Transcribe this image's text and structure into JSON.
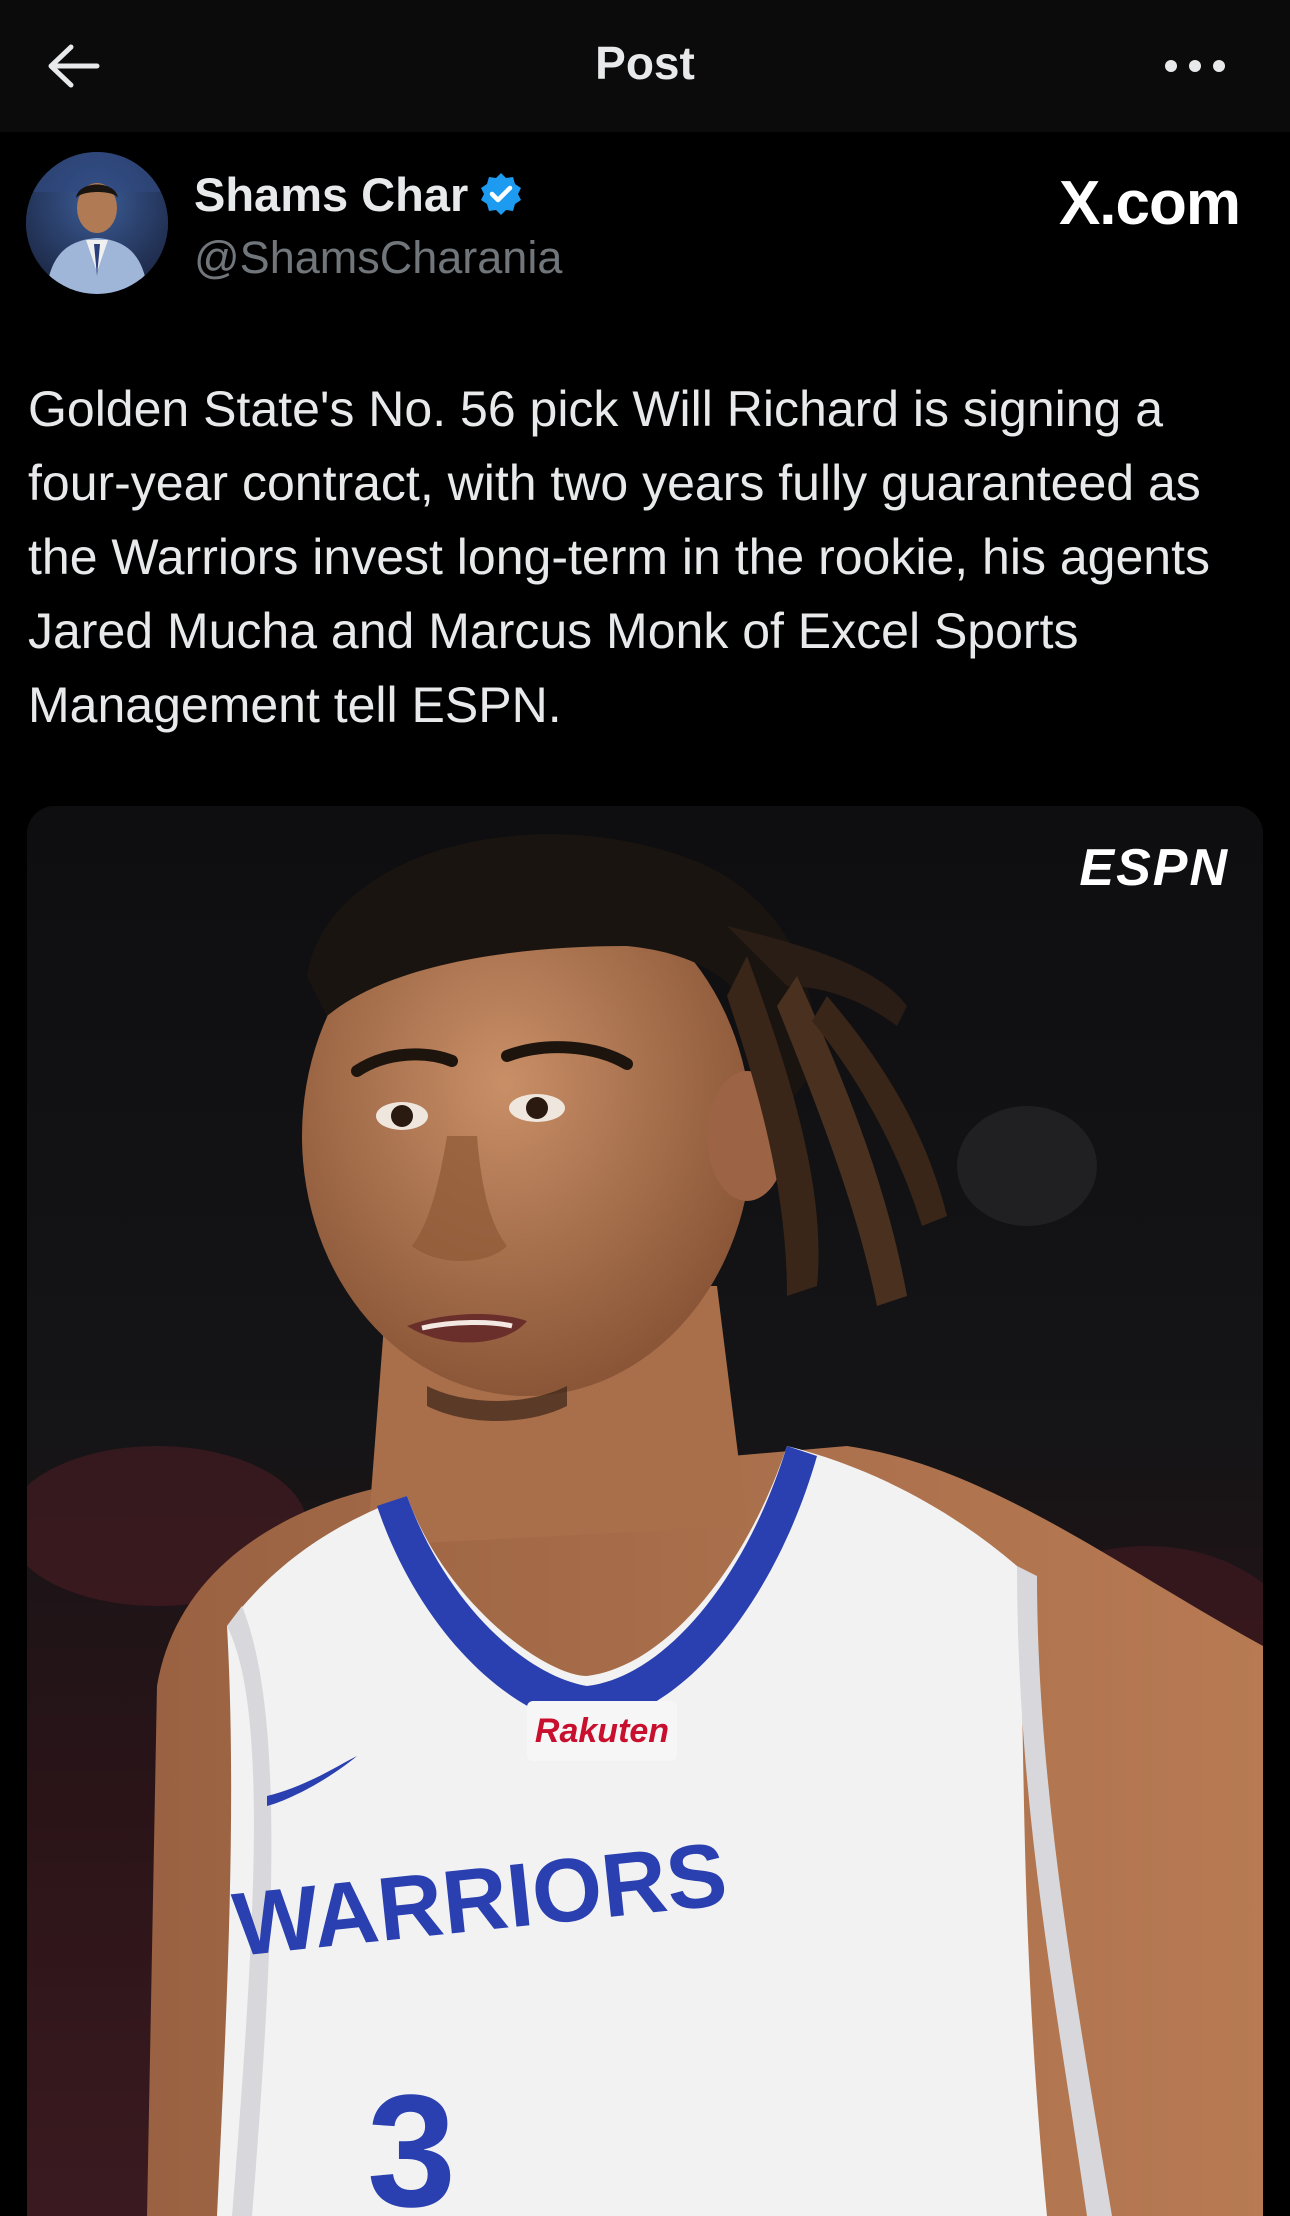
{
  "header": {
    "title": "Post",
    "back_icon": "arrow-left-icon",
    "more_icon": "more-horizontal-icon"
  },
  "author": {
    "display_name": "Shams Char",
    "handle": "@ShamsCharania",
    "verified_color": "#1d9bf0"
  },
  "watermark": "X.com",
  "tweet": {
    "text": "Golden State's No. 56 pick Will Richard is signing a four-year contract, with two years fully guaranteed as the Warriors invest long-term in the rookie, his agents Jared Mucha and Marcus Monk of Excel Sports Management tell ESPN."
  },
  "media": {
    "network_logo": "ESPN",
    "jersey_sponsor": "Rakuten",
    "jersey_team": "WARRIORS",
    "jersey_number": "3"
  },
  "colors": {
    "background": "#000000",
    "topbar": "#0b0b0c",
    "text_primary": "#e7e9ea",
    "text_secondary": "#71767b",
    "jersey_blue": "#2a3fb0"
  }
}
